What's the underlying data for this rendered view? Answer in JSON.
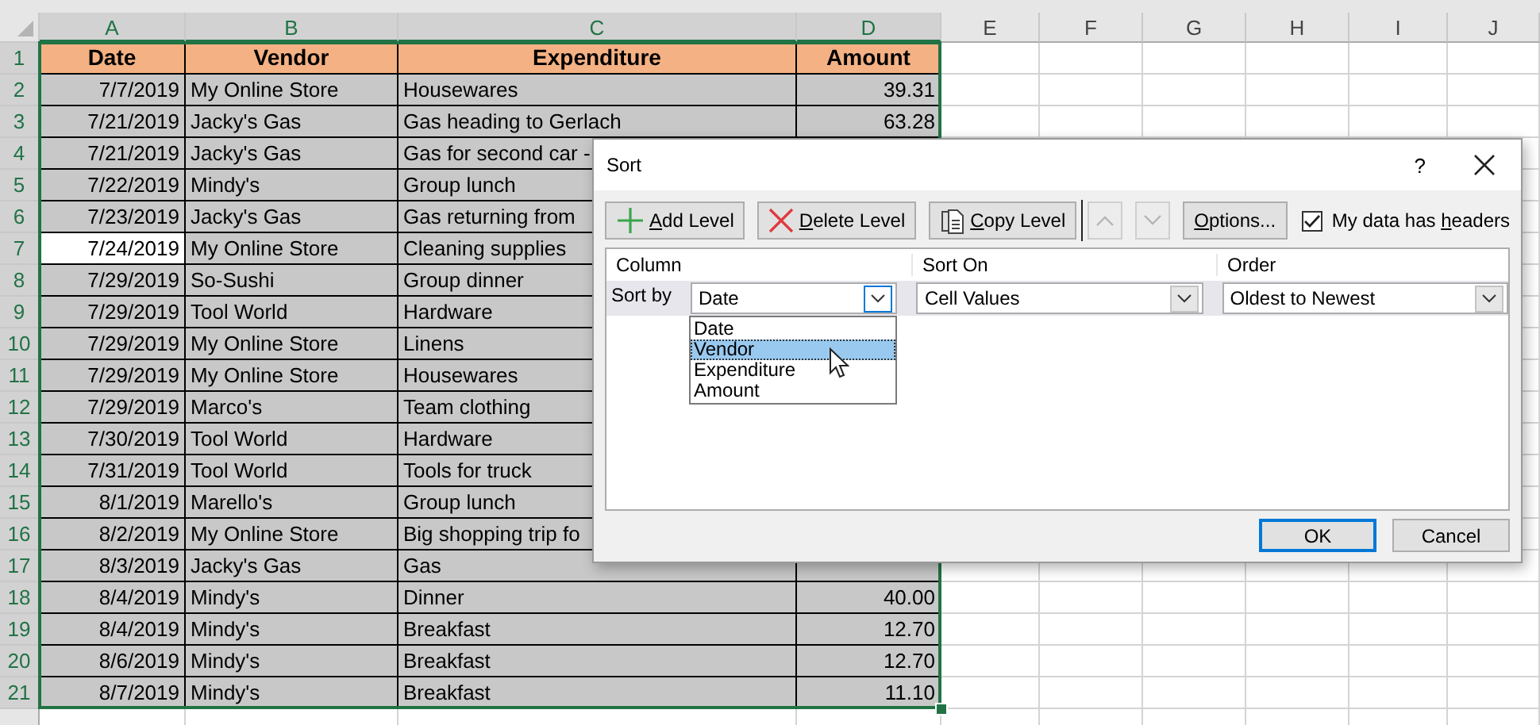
{
  "sheet": {
    "columns": [
      {
        "letter": "A",
        "selected": true
      },
      {
        "letter": "B",
        "selected": true
      },
      {
        "letter": "C",
        "selected": true
      },
      {
        "letter": "D",
        "selected": true
      },
      {
        "letter": "E",
        "selected": false
      },
      {
        "letter": "F",
        "selected": false
      },
      {
        "letter": "G",
        "selected": false
      },
      {
        "letter": "H",
        "selected": false
      },
      {
        "letter": "I",
        "selected": false
      },
      {
        "letter": "J",
        "selected": false
      }
    ],
    "rows": [
      {
        "number": "1",
        "kind": "header",
        "selected": true,
        "active": false,
        "cells": [
          "Date",
          "Vendor",
          "Expenditure",
          "Amount"
        ]
      },
      {
        "number": "2",
        "kind": "data",
        "selected": true,
        "active": false,
        "cells": [
          "7/7/2019",
          "My Online Store",
          "Housewares",
          "39.31"
        ]
      },
      {
        "number": "3",
        "kind": "data",
        "selected": true,
        "active": false,
        "cells": [
          "7/21/2019",
          "Jacky's Gas",
          "Gas heading to Gerlach",
          "63.28"
        ]
      },
      {
        "number": "4",
        "kind": "data",
        "selected": true,
        "active": false,
        "cells": [
          "7/21/2019",
          "Jacky's Gas",
          "Gas for second car -"
        ]
      },
      {
        "number": "5",
        "kind": "data",
        "selected": true,
        "active": false,
        "cells": [
          "7/22/2019",
          "Mindy's",
          "Group lunch"
        ]
      },
      {
        "number": "6",
        "kind": "data",
        "selected": true,
        "active": false,
        "cells": [
          "7/23/2019",
          "Jacky's Gas",
          "Gas returning from"
        ]
      },
      {
        "number": "7",
        "kind": "data",
        "selected": true,
        "active": true,
        "cells": [
          "7/24/2019",
          "My Online Store",
          "Cleaning supplies"
        ]
      },
      {
        "number": "8",
        "kind": "data",
        "selected": true,
        "active": false,
        "cells": [
          "7/29/2019",
          "So-Sushi",
          "Group dinner"
        ]
      },
      {
        "number": "9",
        "kind": "data",
        "selected": true,
        "active": false,
        "cells": [
          "7/29/2019",
          "Tool World",
          "Hardware"
        ]
      },
      {
        "number": "10",
        "kind": "data",
        "selected": true,
        "active": false,
        "cells": [
          "7/29/2019",
          "My Online Store",
          "Linens"
        ]
      },
      {
        "number": "11",
        "kind": "data",
        "selected": true,
        "active": false,
        "cells": [
          "7/29/2019",
          "My Online Store",
          "Housewares"
        ]
      },
      {
        "number": "12",
        "kind": "data",
        "selected": true,
        "active": false,
        "cells": [
          "7/29/2019",
          "Marco's",
          "Team clothing"
        ]
      },
      {
        "number": "13",
        "kind": "data",
        "selected": true,
        "active": false,
        "cells": [
          "7/30/2019",
          "Tool World",
          "Hardware"
        ]
      },
      {
        "number": "14",
        "kind": "data",
        "selected": true,
        "active": false,
        "cells": [
          "7/31/2019",
          "Tool World",
          "Tools for truck"
        ]
      },
      {
        "number": "15",
        "kind": "data",
        "selected": true,
        "active": false,
        "cells": [
          "8/1/2019",
          "Marello's",
          "Group lunch"
        ]
      },
      {
        "number": "16",
        "kind": "data",
        "selected": true,
        "active": false,
        "cells": [
          "8/2/2019",
          "My Online Store",
          "Big shopping trip fo"
        ]
      },
      {
        "number": "17",
        "kind": "data",
        "selected": true,
        "active": false,
        "cells": [
          "8/3/2019",
          "Jacky's Gas",
          "Gas"
        ]
      },
      {
        "number": "18",
        "kind": "data",
        "selected": true,
        "active": false,
        "cells": [
          "8/4/2019",
          "Mindy's",
          "Dinner",
          "40.00"
        ]
      },
      {
        "number": "19",
        "kind": "data",
        "selected": true,
        "active": false,
        "cells": [
          "8/4/2019",
          "Mindy's",
          "Breakfast",
          "12.70"
        ]
      },
      {
        "number": "20",
        "kind": "data",
        "selected": true,
        "active": false,
        "cells": [
          "8/6/2019",
          "Mindy's",
          "Breakfast",
          "12.70"
        ]
      },
      {
        "number": "21",
        "kind": "data",
        "selected": true,
        "active": false,
        "cells": [
          "8/7/2019",
          "Mindy's",
          "Breakfast",
          "11.10"
        ]
      }
    ]
  },
  "dialog": {
    "title": "Sort",
    "help": "?",
    "toolbar": [
      {
        "kind": "add",
        "parts": [
          "A",
          "dd Level"
        ]
      },
      {
        "kind": "delete",
        "parts": [
          "D",
          "elete Level"
        ]
      },
      {
        "kind": "copy",
        "parts": [
          "C",
          "opy Level"
        ]
      },
      {
        "kind": "move_up",
        "disabled": true
      },
      {
        "kind": "move_down",
        "disabled": true
      },
      {
        "kind": "options",
        "parts": [
          "O",
          "ptions..."
        ]
      }
    ],
    "headers_checkbox": {
      "parts": [
        "My data has ",
        "h",
        "eaders"
      ],
      "checked": true
    },
    "columns": [
      "Column",
      "Sort On",
      "Order"
    ],
    "levels": [
      {
        "label": "Sort by",
        "column": "Date",
        "sort_on": "Cell Values",
        "order": "Oldest to Newest"
      }
    ],
    "dropdown": {
      "options": [
        {
          "label": "Date",
          "selected": false
        },
        {
          "label": "Vendor",
          "selected": true
        },
        {
          "label": "Expenditure",
          "selected": false
        },
        {
          "label": "Amount",
          "selected": false
        }
      ]
    },
    "buttons": [
      {
        "label": "OK",
        "default": true
      },
      {
        "label": "Cancel",
        "default": false
      }
    ]
  }
}
